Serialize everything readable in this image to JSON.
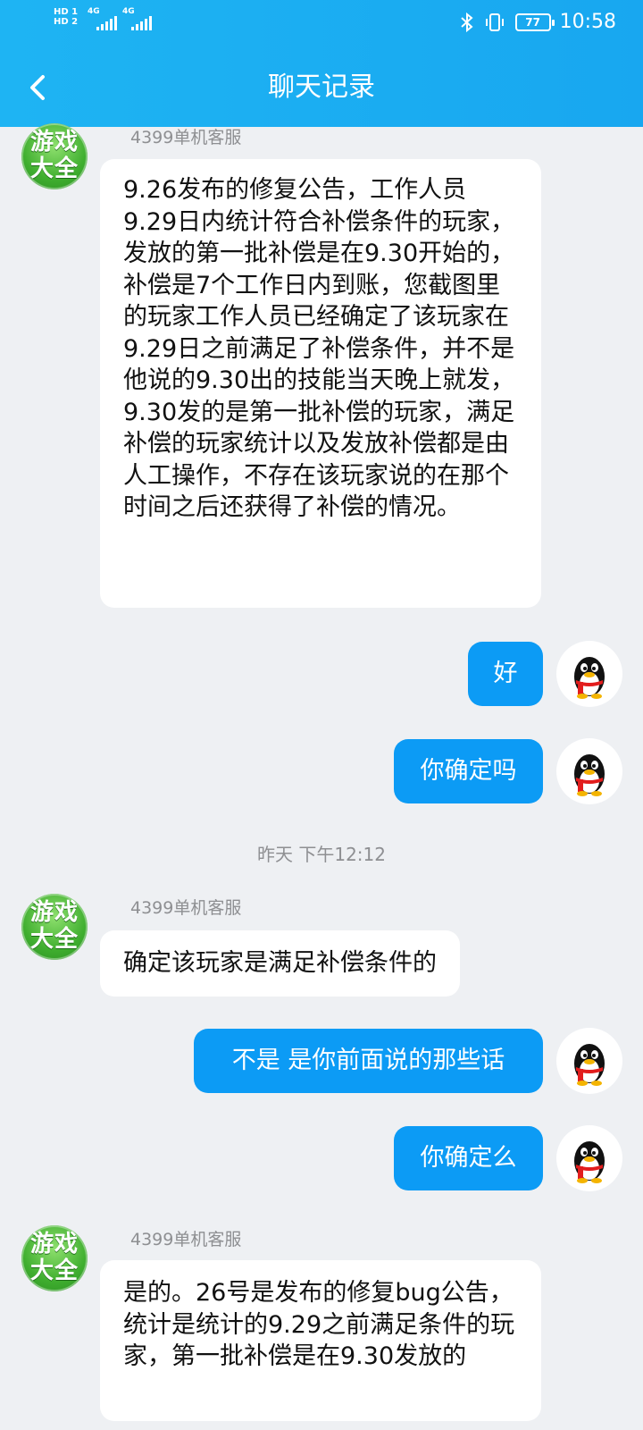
{
  "status": {
    "sim1_label": "HD 1",
    "sim2_label": "HD 2",
    "net1": "4G",
    "net2": "4G",
    "battery": "77",
    "time": "10:58"
  },
  "header": {
    "title": "聊天记录"
  },
  "messages": [
    {
      "side": "left",
      "sender": "4399单机客服",
      "avatar_text": "游戏大全",
      "text": "9.26发布的修复公告，工作人员9.29日内统计符合补偿条件的玩家，发放的第一批补偿是在9.30开始的，补偿是7个工作日内到账，您截图里的玩家工作人员已经确定了该玩家在9.29日之前满足了补偿条件，并不是他说的9.30出的技能当天晚上就发，9.30发的是第一批补偿的玩家，满足补偿的玩家统计以及发放补偿都是由人工操作，不存在该玩家说的在那个时间之后还获得了补偿的情况。"
    },
    {
      "side": "right",
      "text": "好"
    },
    {
      "side": "right",
      "text": "你确定吗"
    },
    {
      "side": "time",
      "text": "昨天 下午12:12"
    },
    {
      "side": "left",
      "sender": "4399单机客服",
      "avatar_text": "游戏大全",
      "text": "确定该玩家是满足补偿条件的"
    },
    {
      "side": "right",
      "text": "不是 是你前面说的那些话"
    },
    {
      "side": "right",
      "text": "你确定么"
    },
    {
      "side": "left",
      "sender": "4399单机客服",
      "avatar_text": "游戏大全",
      "text": "是的。26号是发布的修复bug公告，统计是统计的9.29之前满足条件的玩家，第一批补偿是在9.30发放的"
    }
  ],
  "colors": {
    "header_bg": "#1eb4f3",
    "bubble_self": "#0c9bf5",
    "bubble_other": "#ffffff",
    "page_bg": "#eef0f3"
  },
  "icons": {
    "back": "chevron-left-icon",
    "bluetooth": "bluetooth-icon",
    "vibrate": "vibrate-icon",
    "battery": "battery-icon",
    "user_avatar": "qq-penguin-icon"
  }
}
